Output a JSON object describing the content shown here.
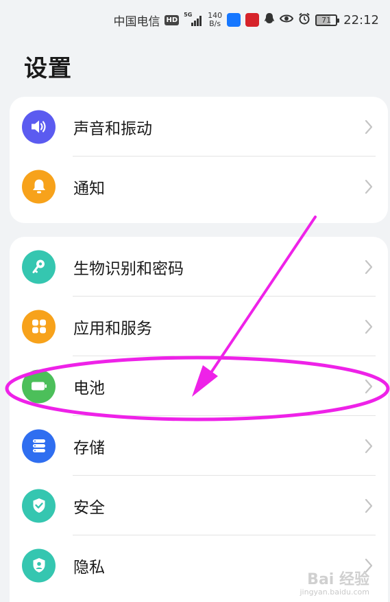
{
  "status_bar": {
    "carrier": "中国电信",
    "hd_badge": "HD",
    "network_tag": "5G",
    "speed_value": "140",
    "speed_unit": "B/s",
    "battery": "71",
    "time": "22:12"
  },
  "page": {
    "title": "设置"
  },
  "groups": [
    {
      "items": [
        {
          "label": "声音和振动",
          "icon": "speaker-icon",
          "color": "#5b5bf0"
        },
        {
          "label": "通知",
          "icon": "bell-icon",
          "color": "#f7a21b"
        }
      ]
    },
    {
      "items": [
        {
          "label": "生物识别和密码",
          "icon": "key-icon",
          "color": "#35c6b0"
        },
        {
          "label": "应用和服务",
          "icon": "apps-grid-icon",
          "color": "#f7a21b"
        },
        {
          "label": "电池",
          "icon": "battery-icon",
          "color": "#4cbf5a"
        },
        {
          "label": "存储",
          "icon": "storage-icon",
          "color": "#2f6ef0"
        },
        {
          "label": "安全",
          "icon": "shield-check-icon",
          "color": "#35c6b0"
        },
        {
          "label": "隐私",
          "icon": "privacy-shield-icon",
          "color": "#35c6b0"
        }
      ]
    }
  ],
  "annotation": {
    "color": "#ee22e8"
  },
  "watermark": {
    "main": "Bai 经验",
    "sub": "jingyan.baidu.com"
  }
}
